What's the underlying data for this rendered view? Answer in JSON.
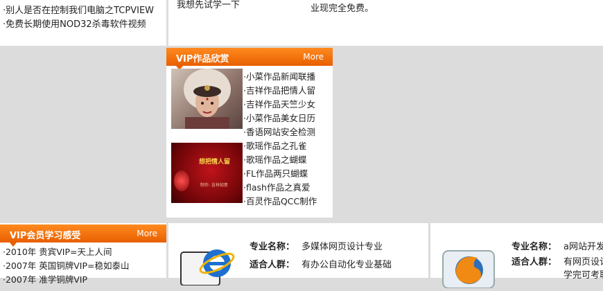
{
  "top": {
    "left_items": [
      "·别人是否在控制我们电脑之TCPVIEW",
      "·免费长期使用NOD32杀毒软件视频"
    ],
    "mid_text": "我想先试学一下",
    "right_text": "业现完全免费。"
  },
  "vip_works": {
    "title": "VIP作品欣赏",
    "more": "More",
    "items": [
      "·小菜作品新闻联播",
      "·吉祥作品把情人留",
      "·吉祥作品天竺少女",
      "·小菜作品美女日历",
      "·香语网站安全检测",
      "·歌瑶作品之孔雀",
      "·歌瑶作品之蝴蝶",
      "·FL作品两只蝴蝶",
      "·flash作品之真爱",
      "·百灵作品QCC制作"
    ],
    "thumb2_title": "想把情人留",
    "thumb2_sub": "制作: 吉祥如意"
  },
  "vip_feelings": {
    "title": "VIP会员学习感受",
    "more": "More",
    "items": [
      "·2010年 贵宾VIP=天上人间",
      "·2007年 英国铜牌VIP=稳如泰山",
      "·2007年 准学铜牌VIP"
    ]
  },
  "course1": {
    "name_label": "专业名称：",
    "name_value": "多媒体网页设计专业",
    "people_label": "适合人群：",
    "people_value": "有办公自动化专业基础"
  },
  "course2": {
    "name_label": "专业名称：",
    "name_value": "a网站开发",
    "people_label": "适合人群：",
    "people_value": "有网页设计",
    "extra_value": "学完可考取"
  },
  "colors": {
    "accent": "#f06a00",
    "bg": "#dcdcdc"
  }
}
